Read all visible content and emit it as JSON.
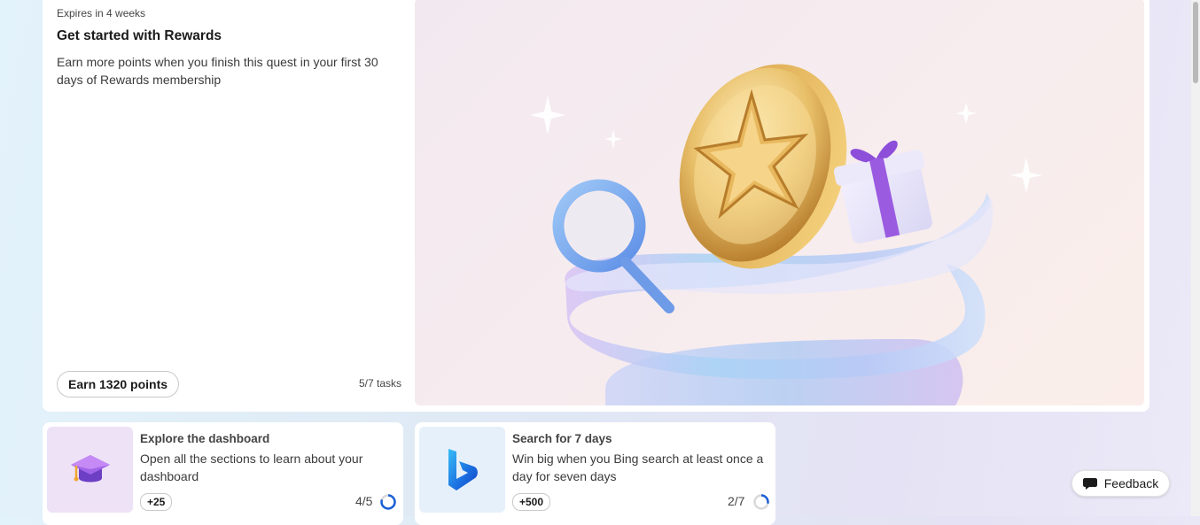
{
  "quest": {
    "expires": "Expires in 4 weeks",
    "title": "Get started with Rewards",
    "description": "Earn more points when you finish this quest in your first 30 days of Rewards membership",
    "earn_button": "Earn 1320 points",
    "tasks": "5/7 tasks"
  },
  "tasks": [
    {
      "title": "Explore the dashboard",
      "description": "Open all the sections to learn about your dashboard",
      "points": "+25",
      "progress": "4/5",
      "progress_fraction": 0.8,
      "icon": "graduation-cap-icon"
    },
    {
      "title": "Search for 7 days",
      "description": "Win big when you Bing search at least once a day for seven days",
      "points": "+500",
      "progress": "2/7",
      "progress_fraction": 0.2857,
      "icon": "bing-logo-icon"
    }
  ],
  "feedback": {
    "label": "Feedback",
    "icon": "chat-bubble-icon"
  },
  "colors": {
    "accent": "#1a5fd6",
    "ring_track": "#d9d9d9"
  }
}
